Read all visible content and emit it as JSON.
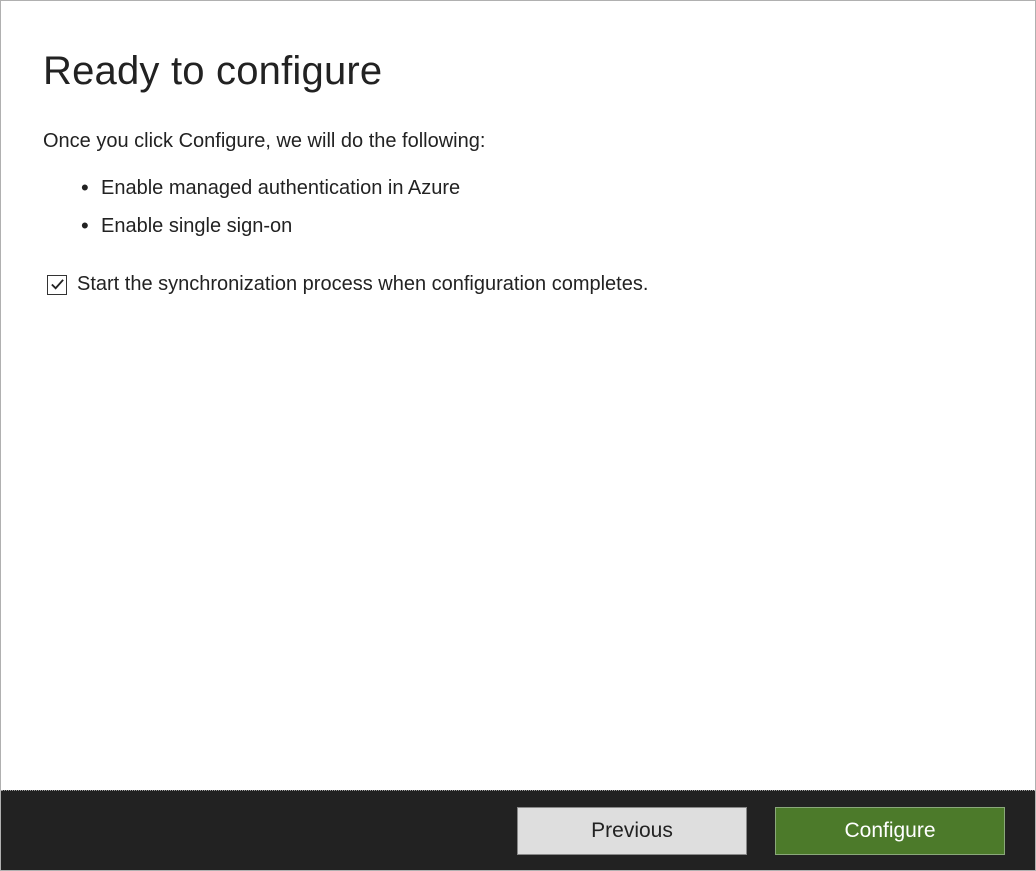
{
  "header": {
    "title": "Ready to configure"
  },
  "intro": "Once you click Configure, we will do the following:",
  "tasks": [
    "Enable managed authentication in Azure",
    "Enable single sign-on"
  ],
  "checkbox": {
    "checked": true,
    "label": "Start the synchronization process when configuration completes."
  },
  "footer": {
    "previous_label": "Previous",
    "configure_label": "Configure"
  }
}
